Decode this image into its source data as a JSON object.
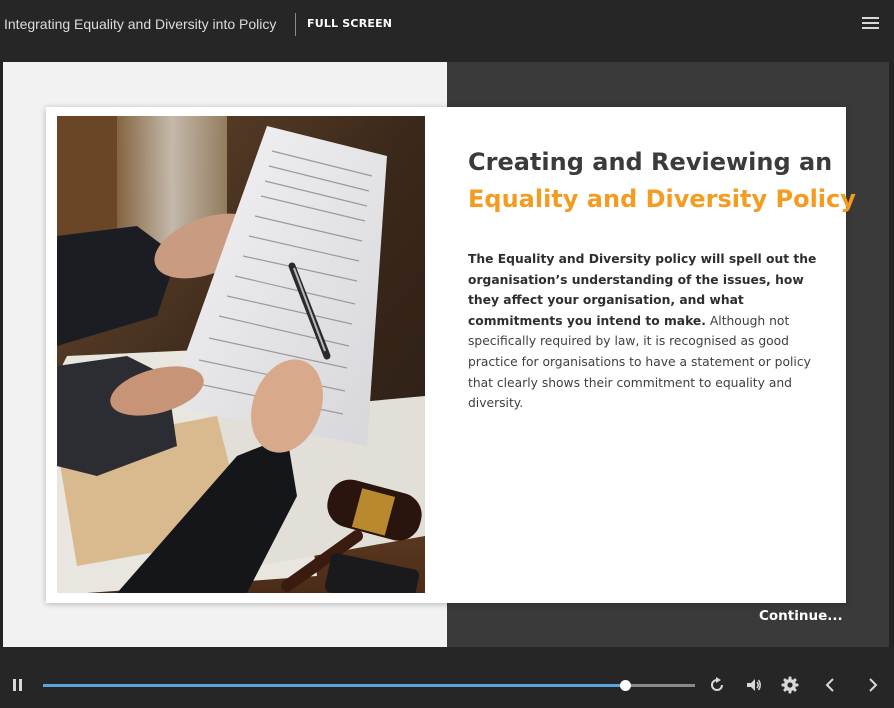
{
  "header": {
    "course_title": "Integrating Equality and Diversity into Policy",
    "fullscreen_label": "FULL SCREEN",
    "menu_icon": "hamburger-menu-icon"
  },
  "slide": {
    "heading_line1": "Creating and Reviewing an",
    "heading_line2": "Equality and Diversity Policy",
    "body_bold": "The Equality and Diversity policy will spell out the organisation’s understanding of the issues, how they affect your organisation, and what commitments you intend to make.",
    "body_regular": " Although not specifically required by law, it is recognised as good practice for organisations to have a statement or policy that clearly shows their commitment to equality and diversity.",
    "image": "document-review-photo",
    "continue_label": "Continue..."
  },
  "player": {
    "progress": 0.893,
    "icons": [
      "pause-icon",
      "replay-icon",
      "volume-icon",
      "settings-icon",
      "previous-icon",
      "next-icon"
    ]
  },
  "colors": {
    "accent_orange": "#f39c1f",
    "progress_blue": "#5aa5dd",
    "bar_background": "#262626"
  }
}
